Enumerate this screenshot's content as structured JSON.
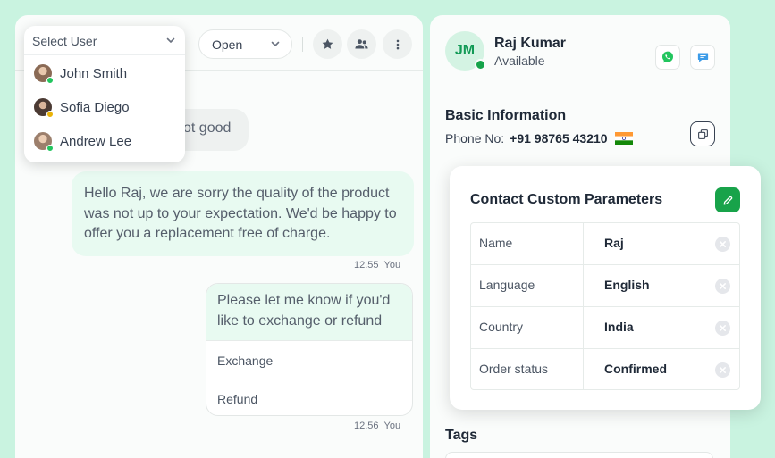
{
  "chat": {
    "status_select": "Open",
    "incoming_partial": "ot good",
    "outgoing_1": "Hello Raj, we are sorry the quality of the product was not up to your expectation. We'd be happy to offer you a replacement free of charge.",
    "outgoing_1_time": "12.55",
    "outgoing_1_sender": "You",
    "outgoing_2": "Please let me know if you'd like to exchange or refund",
    "reply_options": [
      "Exchange",
      "Refund"
    ],
    "outgoing_2_time": "12.56",
    "outgoing_2_sender": "You"
  },
  "user_dropdown": {
    "placeholder": "Select User",
    "users": [
      {
        "name": "John Smith",
        "status_color": "#22c55e",
        "avatar_color": "#8a6a55"
      },
      {
        "name": "Sofia Diego",
        "status_color": "#eab308",
        "avatar_color": "#4b3a33"
      },
      {
        "name": "Andrew Lee",
        "status_color": "#22c55e",
        "avatar_color": "#9c7f6c"
      }
    ]
  },
  "contact": {
    "initials": "JM",
    "name": "Raj Kumar",
    "status": "Available",
    "basic_info_title": "Basic Information",
    "phone_label": "Phone No:",
    "phone_number": "+91 98765 43210",
    "tags_title": "Tags"
  },
  "params": {
    "title": "Contact Custom Parameters",
    "rows": [
      {
        "key": "Name",
        "value": "Raj"
      },
      {
        "key": "Language",
        "value": "English"
      },
      {
        "key": "Country",
        "value": "India"
      },
      {
        "key": "Order status",
        "value": "Confirmed"
      }
    ]
  },
  "colors": {
    "background": "#c9f3e0",
    "accent_green": "#18a34a",
    "bubble_out": "#e8faf1"
  },
  "icons": {
    "whatsapp": "whatsapp-icon",
    "chat": "chat-bubble-icon",
    "star": "star-icon",
    "users": "users-icon",
    "more": "more-vertical-icon",
    "copy": "copy-icon",
    "edit": "pencil-icon",
    "remove": "close-circle-icon"
  }
}
